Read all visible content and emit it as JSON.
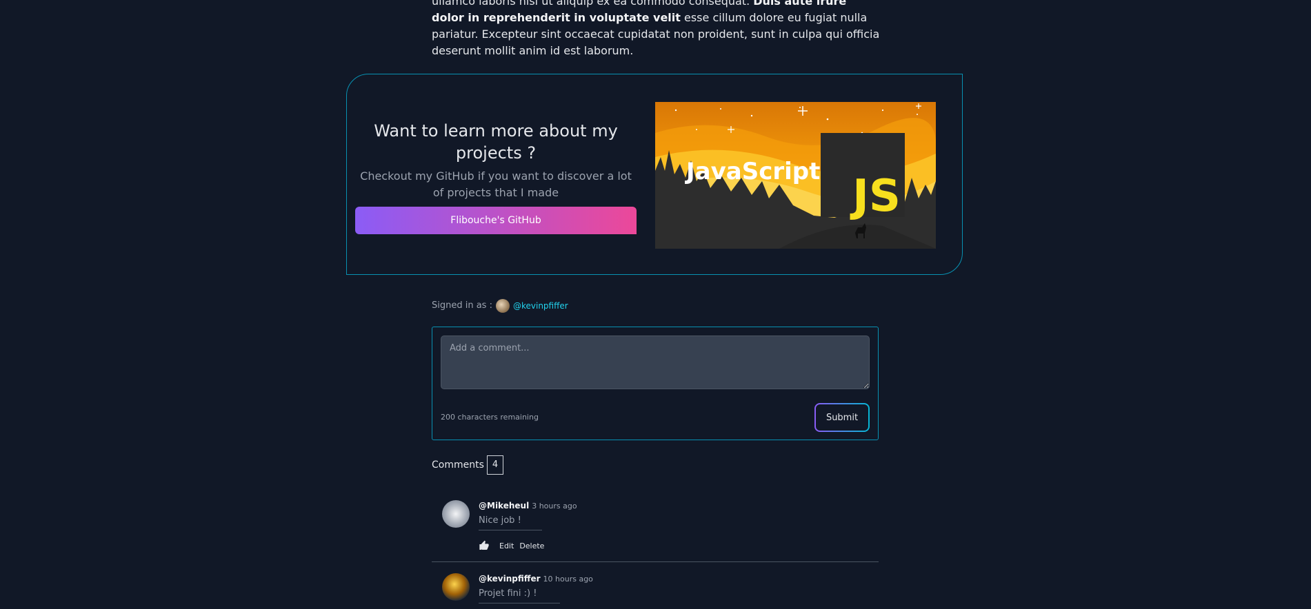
{
  "article": {
    "line1_normal": "ullamco laboris nisi ut aliquip ex ea commodo consequat. ",
    "line1_bold": "Duis aute irure dolor in reprehenderit in voluptate velit",
    "rest": " esse cillum dolore eu fugiat nulla pariatur. Excepteur sint occaecat cupidatat non proident, sunt in culpa qui officia deserunt mollit anim id est laborum."
  },
  "cta": {
    "title": "Want to learn more about my projects ?",
    "subtitle": "Checkout my GitHub if you want to discover a lot of projects that I made",
    "button_label": "Flibouche's GitHub",
    "image_wordmark": "JavaScript",
    "image_logo": "JS"
  },
  "signed_in": {
    "label": "Signed in as :",
    "username": "@kevinpfiffer"
  },
  "comment_form": {
    "placeholder": "Add a comment...",
    "chars_remaining": "200 characters remaining",
    "submit_label": "Submit"
  },
  "comments": {
    "label": "Comments",
    "count": "4",
    "items": [
      {
        "author": "@Mikeheul",
        "time": "3 hours ago",
        "text": "Nice job !",
        "edit_label": "Edit",
        "delete_label": "Delete"
      },
      {
        "author": "@kevinpfiffer",
        "time": "10 hours ago",
        "text": "Projet fini :) !"
      }
    ]
  },
  "colors": {
    "background": "#111827",
    "accent_cyan": "#0891b2",
    "gradient_start": "#8b5cf6",
    "gradient_end": "#ec4899"
  },
  "icons": [
    "thumbs-up-icon"
  ]
}
